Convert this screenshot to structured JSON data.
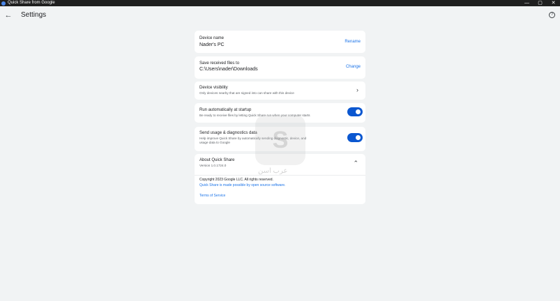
{
  "window": {
    "title": "Quick Share from Google",
    "controls": {
      "minimize": "—",
      "maximize": "▢",
      "close": "✕"
    }
  },
  "header": {
    "back_icon": "arrow-left-icon",
    "title": "Settings",
    "help_icon": "help-circle-icon",
    "help_glyph": "?"
  },
  "settings": {
    "device_name": {
      "title": "Device name",
      "value": "Nader's PC",
      "action": "Rename"
    },
    "save_location": {
      "title": "Save received files to",
      "value": "C:\\Users\\nader\\Downloads",
      "action": "Change"
    },
    "visibility": {
      "title": "Device visibility",
      "description": "Only devices nearby that are signed into  can share with this device",
      "chevron": "›"
    },
    "startup": {
      "title": "Run automatically at startup",
      "description": "Be ready to receive files by letting Quick Share run when your computer starts",
      "enabled": true
    },
    "diagnostics": {
      "title": "Send usage & diagnostics data",
      "description_line1": "Help improve Quick Share by automatically sending diagnostic, device, and",
      "description_line2": "usage data to Google",
      "enabled": true
    },
    "about": {
      "title": "About Quick Share",
      "version": "Version 1.0.1724.0",
      "chevron": "⌃",
      "copyright": "Copyright 2023 Google LLC. All rights reserved.",
      "open_source": "Quick Share is made possible by open source software.",
      "terms": "Terms of Service"
    }
  },
  "colors": {
    "accent": "#1a73e8",
    "toggle_on": "#0b57d0",
    "background": "#f1f3f4",
    "card": "#ffffff"
  },
  "watermark": {
    "text": "عرب اسن",
    "logo": "S"
  }
}
